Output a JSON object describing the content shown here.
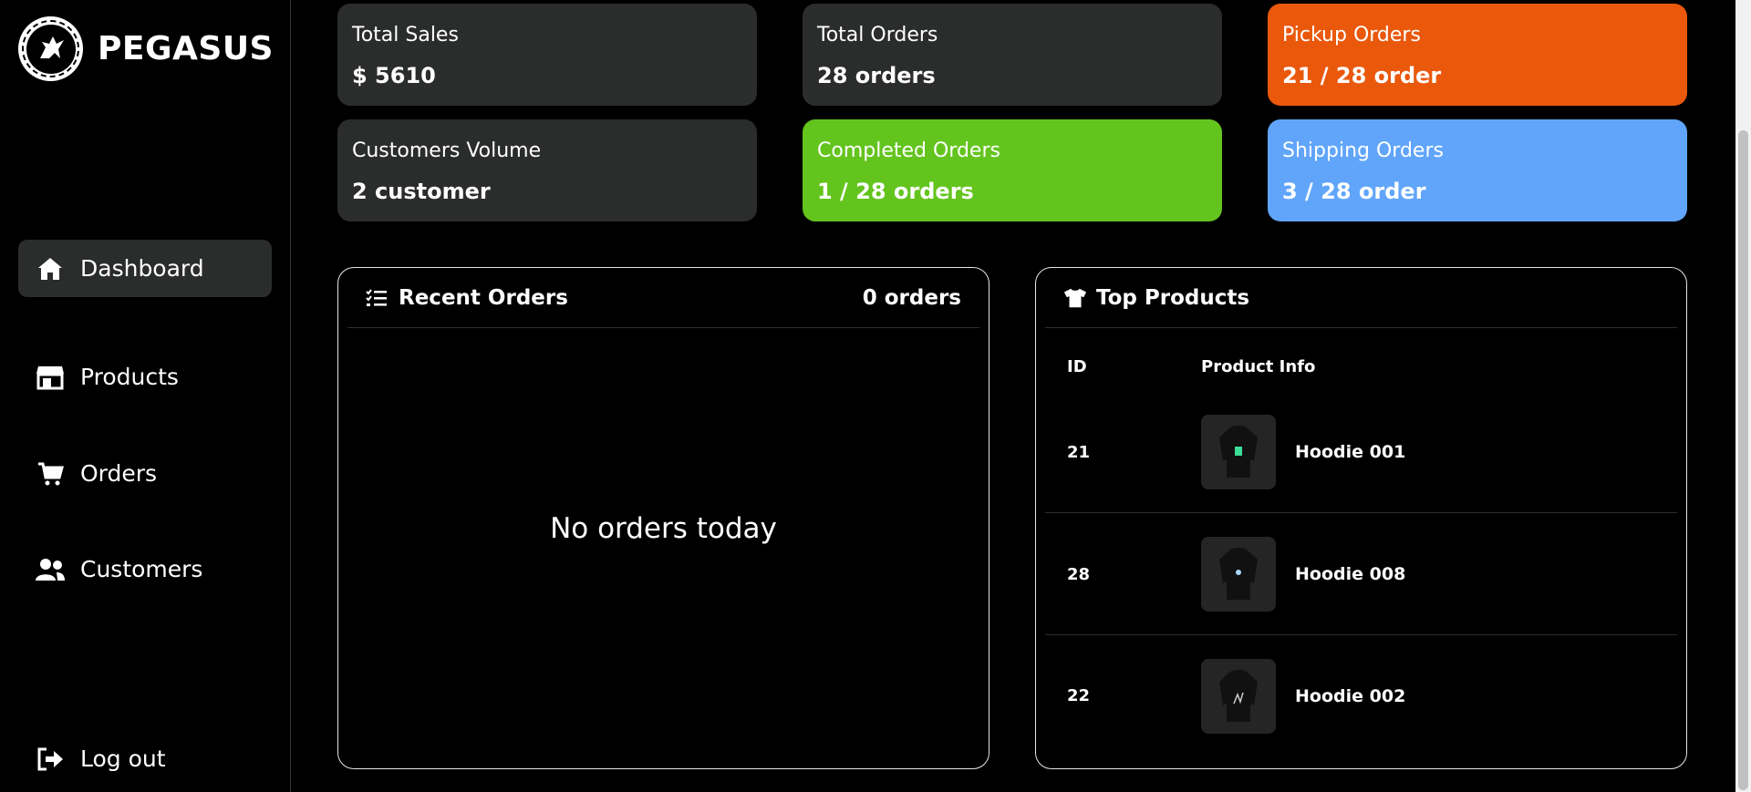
{
  "brand": {
    "name": "PEGASUS"
  },
  "nav": [
    {
      "label": "Dashboard",
      "icon": "home-icon",
      "active": true
    },
    {
      "label": "Products",
      "icon": "store-icon"
    },
    {
      "label": "Orders",
      "icon": "cart-icon"
    },
    {
      "label": "Customers",
      "icon": "users-icon"
    }
  ],
  "logout": {
    "label": "Log out",
    "icon": "logout-icon"
  },
  "stats": {
    "total_sales": {
      "label": "Total Sales",
      "value": "$ 5610"
    },
    "total_orders": {
      "label": "Total Orders",
      "value": "28 orders"
    },
    "pickup_orders": {
      "label": "Pickup Orders",
      "value": "21 / 28 order"
    },
    "customers_volume": {
      "label": "Customers Volume",
      "value": "2 customer"
    },
    "completed_orders": {
      "label": "Completed Orders",
      "value": "1 / 28 orders"
    },
    "shipping_orders": {
      "label": "Shipping Orders",
      "value": "3 / 28 order"
    }
  },
  "colors": {
    "card_default": "#2b2c2c",
    "pickup": "#ea580c",
    "completed": "#64c41e",
    "shipping": "#60a5fa"
  },
  "recent_orders": {
    "title": "Recent Orders",
    "count": "0 orders",
    "empty_message": "No orders today",
    "icon": "checklist-icon"
  },
  "top_products": {
    "title": "Top Products",
    "icon": "tshirt-icon",
    "columns": [
      "ID",
      "Product Info"
    ],
    "rows": [
      {
        "id": "21",
        "name": "Hoodie 001"
      },
      {
        "id": "28",
        "name": "Hoodie 008"
      },
      {
        "id": "22",
        "name": "Hoodie 002"
      }
    ]
  }
}
